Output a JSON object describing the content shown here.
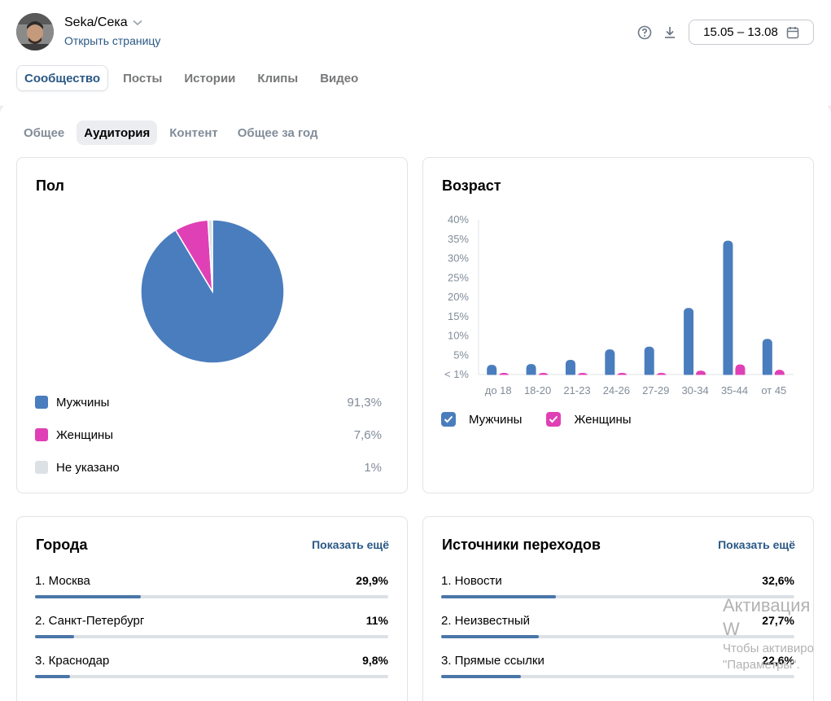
{
  "header": {
    "group_name": "Seka/Сека",
    "open_page": "Открыть страницу",
    "date_range": "15.05 – 13.08",
    "icons": [
      "help-icon",
      "download-icon",
      "calendar-icon",
      "chevron-down-icon"
    ]
  },
  "tabs": [
    {
      "label": "Сообщество",
      "active": true
    },
    {
      "label": "Посты"
    },
    {
      "label": "Истории"
    },
    {
      "label": "Клипы"
    },
    {
      "label": "Видео"
    }
  ],
  "subtabs": [
    {
      "label": "Общее"
    },
    {
      "label": "Аудитория",
      "active": true
    },
    {
      "label": "Контент"
    },
    {
      "label": "Общее за год"
    }
  ],
  "gender": {
    "title": "Пол",
    "items": [
      {
        "label": "Мужчины",
        "value": "91,3%",
        "pct": 91.3,
        "color": "#4a7dbd"
      },
      {
        "label": "Женщины",
        "value": "7,6%",
        "pct": 7.6,
        "color": "#e040b5"
      },
      {
        "label": "Не указано",
        "value": "1%",
        "pct": 1.0,
        "color": "#dce1e6"
      }
    ]
  },
  "age": {
    "title": "Возраст",
    "legend_men": "Мужчины",
    "legend_women": "Женщины",
    "colors": {
      "men": "#4a7dbd",
      "women": "#e040b5"
    }
  },
  "chart_data": {
    "type": "bar",
    "categories": [
      "до 18",
      "18-20",
      "21-23",
      "24-26",
      "27-29",
      "30-34",
      "35-44",
      "от 45"
    ],
    "series": [
      {
        "name": "Мужчины",
        "values": [
          2.5,
          2.7,
          3.8,
          6.5,
          7.2,
          17.2,
          34.6,
          9.2
        ]
      },
      {
        "name": "Женщины",
        "values": [
          0.3,
          0.3,
          0.3,
          0.4,
          0.4,
          1.0,
          2.6,
          1.2
        ]
      }
    ],
    "yticks": [
      "< 1%",
      "5%",
      "10%",
      "15%",
      "20%",
      "25%",
      "30%",
      "35%",
      "40%"
    ],
    "ylim": [
      0,
      40
    ],
    "xlabel": "",
    "ylabel": ""
  },
  "cities": {
    "title": "Города",
    "show_more": "Показать ещё",
    "items": [
      {
        "label": "1. Москва",
        "value": "29,9%",
        "pct": 29.9
      },
      {
        "label": "2. Санкт-Петербург",
        "value": "11%",
        "pct": 11
      },
      {
        "label": "3. Краснодар",
        "value": "9,8%",
        "pct": 9.8
      }
    ]
  },
  "sources": {
    "title": "Источники переходов",
    "show_more": "Показать ещё",
    "items": [
      {
        "label": "1. Новости",
        "value": "32,6%",
        "pct": 32.6
      },
      {
        "label": "2. Неизвестный",
        "value": "27,7%",
        "pct": 27.7
      },
      {
        "label": "3. Прямые ссылки",
        "value": "22,6%",
        "pct": 22.6
      }
    ]
  },
  "watermark": {
    "line1": "Активация W",
    "line2": "Чтобы активиро",
    "line3": "\"Параметры\"."
  }
}
